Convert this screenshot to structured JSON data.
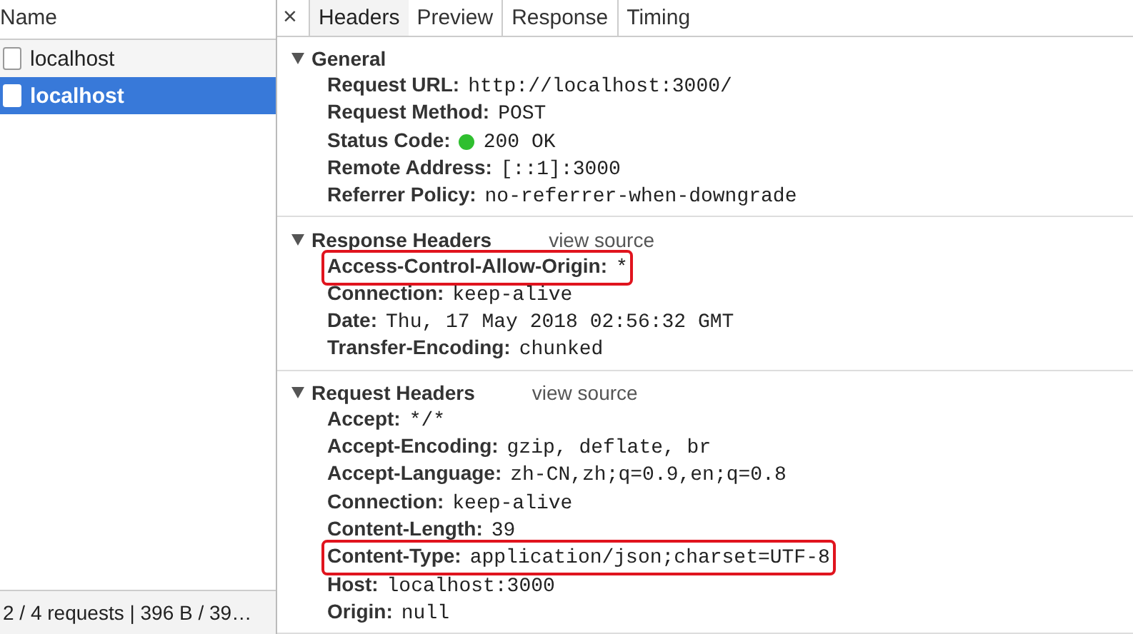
{
  "sidebar": {
    "header": "Name",
    "items": [
      {
        "label": "localhost",
        "selected": false
      },
      {
        "label": "localhost",
        "selected": true
      }
    ],
    "status_bar": "2 / 4 requests | 396 B / 39…"
  },
  "close_label": "×",
  "tabs": [
    {
      "label": "Headers",
      "selected": true
    },
    {
      "label": "Preview",
      "selected": false
    },
    {
      "label": "Response",
      "selected": false
    },
    {
      "label": "Timing",
      "selected": false
    }
  ],
  "sections": [
    {
      "title": "General",
      "expanded": true,
      "rows": [
        {
          "name": "Request URL:",
          "value": "http://localhost:3000/",
          "highlighted": false
        },
        {
          "name": "Request Method:",
          "value": "POST",
          "highlighted": false
        },
        {
          "name": "Status Code:",
          "value": "200 OK",
          "highlighted": false,
          "kind": "status",
          "color": "#2fbf2f"
        },
        {
          "name": "Remote Address:",
          "value": "[::1]:3000",
          "highlighted": false
        },
        {
          "name": "Referrer Policy:",
          "value": "no-referrer-when-downgrade",
          "highlighted": false
        }
      ]
    },
    {
      "title": "Response Headers",
      "link": "view source",
      "expanded": true,
      "rows": [
        {
          "name": "Access-Control-Allow-Origin:",
          "value": "*",
          "highlighted": true
        },
        {
          "name": "Connection:",
          "value": "keep-alive",
          "highlighted": false
        },
        {
          "name": "Date:",
          "value": "Thu, 17 May 2018 02:56:32 GMT",
          "highlighted": false
        },
        {
          "name": "Transfer-Encoding:",
          "value": "chunked",
          "highlighted": false
        }
      ]
    },
    {
      "title": "Request Headers",
      "link": "view source",
      "expanded": true,
      "rows": [
        {
          "name": "Accept:",
          "value": "*/*",
          "highlighted": false
        },
        {
          "name": "Accept-Encoding:",
          "value": "gzip, deflate, br",
          "highlighted": false
        },
        {
          "name": "Accept-Language:",
          "value": "zh-CN,zh;q=0.9,en;q=0.8",
          "highlighted": false
        },
        {
          "name": "Connection:",
          "value": "keep-alive",
          "highlighted": false
        },
        {
          "name": "Content-Length:",
          "value": "39",
          "highlighted": false
        },
        {
          "name": "Content-Type:",
          "value": "application/json;charset=UTF-8",
          "highlighted": true
        },
        {
          "name": "Host:",
          "value": "localhost:3000",
          "highlighted": false
        },
        {
          "name": "Origin:",
          "value": "null",
          "highlighted": false
        }
      ]
    }
  ]
}
